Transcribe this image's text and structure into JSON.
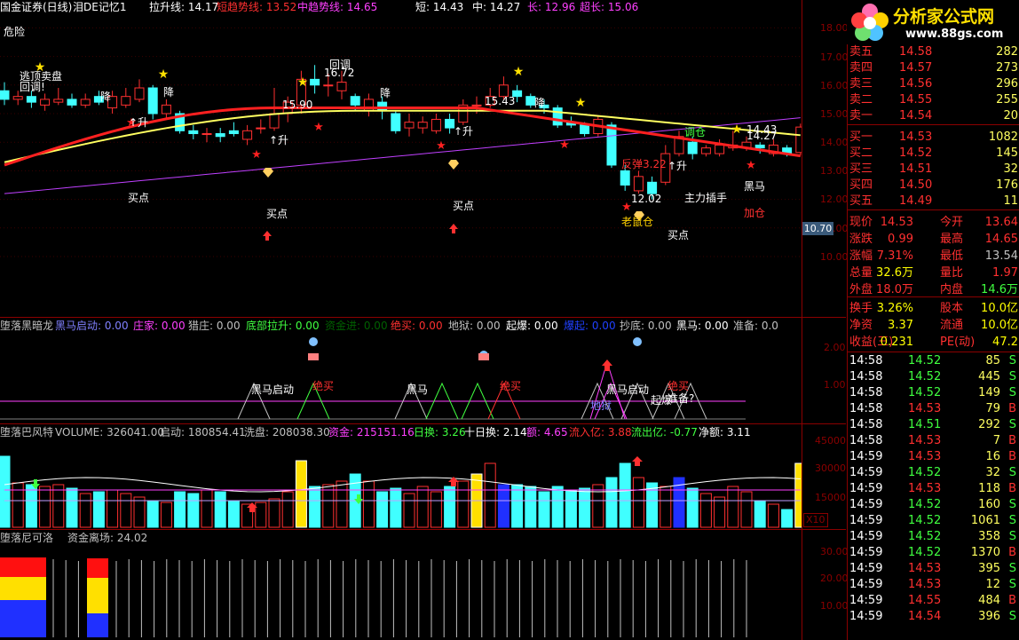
{
  "header": {
    "title": "国金证券(日线)",
    "formula": "泪DE记忆1",
    "items": [
      {
        "label": "拉升线: 14.17",
        "color": "#ffffff"
      },
      {
        "label": "短趋势线: 13.52",
        "color": "#ff3030"
      },
      {
        "label": "中趋势线: 14.65",
        "color": "#ff40ff"
      },
      {
        "label": "短: 14.43",
        "color": "#ffffff"
      },
      {
        "label": "中: 14.27",
        "color": "#ffffff"
      },
      {
        "label": "长: 12.96",
        "color": "#ff40ff"
      },
      {
        "label": "超长: 15.06",
        "color": "#ff40ff"
      }
    ]
  },
  "main_labels": {
    "danger": "危险",
    "price_badge": "10.70"
  },
  "price_axis": [
    "18.00",
    "17.00",
    "16.00",
    "15.00",
    "14.00",
    "13.00",
    "12.00",
    "11.00",
    "10.00"
  ],
  "chart_annotations": [
    {
      "text": "逃顶卖盘",
      "color": "#ffffff"
    },
    {
      "text": "回调!",
      "color": "#ffffff"
    },
    {
      "text": "降",
      "color": "#ffffff"
    },
    {
      "text": "回调",
      "color": "#ffffff"
    },
    {
      "text": "16.72",
      "color": "#ffffff"
    },
    {
      "text": "15.90",
      "color": "#ffffff"
    },
    {
      "text": "15.43",
      "color": "#ffffff"
    },
    {
      "text": "买点",
      "color": "#ffffff"
    },
    {
      "text": "黑马",
      "color": "#ffffff"
    },
    {
      "text": "加仓",
      "color": "#ff3030"
    },
    {
      "text": "主力插手",
      "color": "#ffffff"
    },
    {
      "text": "老鼠仓",
      "color": "#ffd000"
    },
    {
      "text": "12.02",
      "color": "#ffffff"
    },
    {
      "text": "反弹3.22",
      "color": "#ff3030"
    },
    {
      "text": "↑升",
      "color": "#ffffff"
    },
    {
      "text": "14.43",
      "color": "#ffffff"
    },
    {
      "text": "14.27",
      "color": "#ffffff"
    },
    {
      "text": "调仓",
      "color": "#40ff40"
    }
  ],
  "panel2": {
    "title": "堕落黑暗龙",
    "items": [
      {
        "label": "黑马启动: 0.00",
        "color": "#8080ff"
      },
      {
        "label": "庄家: 0.00",
        "color": "#ff40ff"
      },
      {
        "label": "猎庄: 0.00",
        "color": "#c0c0c0"
      },
      {
        "label": "底部拉升: 0.00",
        "color": "#40ff40"
      },
      {
        "label": "资金进: 0.00",
        "color": "#006000"
      },
      {
        "label": "绝买: 0.00",
        "color": "#ff3030"
      },
      {
        "label": "地狱: 0.00",
        "color": "#c0c0c0"
      },
      {
        "label": "起爆: 0.00",
        "color": "#ffffff"
      },
      {
        "label": "爆起: 0.00",
        "color": "#2040ff"
      },
      {
        "label": "抄底: 0.00",
        "color": "#c0c0c0"
      },
      {
        "label": "黑马: 0.00",
        "color": "#ffffff"
      },
      {
        "label": "准备: 0.0",
        "color": "#c0c0c0"
      }
    ],
    "axis": [
      "2.00",
      "1.00"
    ],
    "marks": [
      "黑马启动",
      "绝买",
      "黑马",
      "绝买",
      "黑马启动",
      "绝买",
      "地狱",
      "起爆",
      "准备?"
    ]
  },
  "panel3": {
    "title": "堕落巴风特",
    "items": [
      {
        "label": "VOLUME: 326041.00",
        "color": "#c0c0c0"
      },
      {
        "label": "启动: 180854.41",
        "color": "#c0c0c0"
      },
      {
        "label": "洗盘: 208038.30",
        "color": "#c0c0c0"
      },
      {
        "label": "资金: 215151.16",
        "color": "#ff40ff"
      },
      {
        "label": "日换: 3.26",
        "color": "#40ff40"
      },
      {
        "label": "十日换: 2.14",
        "color": "#ffffff"
      },
      {
        "label": "额: 4.65",
        "color": "#ff40ff"
      },
      {
        "label": "流入亿: 3.88",
        "color": "#ff3030"
      },
      {
        "label": "流出亿: -0.77",
        "color": "#40ff40"
      },
      {
        "label": "净额: 3.11",
        "color": "#ffffff"
      }
    ],
    "axis": [
      "45000",
      "30000",
      "15000"
    ],
    "unit": "X10"
  },
  "panel4": {
    "title": "堕落尼可洛",
    "items": [
      {
        "label": "资金离场: 24.02",
        "color": "#c0c0c0"
      }
    ],
    "axis": [
      "30.00",
      "20.00",
      "10.00"
    ]
  },
  "logo": {
    "text": "分析家公式网",
    "url": "www.88gs.com"
  },
  "quote": {
    "asks": [
      {
        "label": "卖五",
        "price": "14.58",
        "vol": "282"
      },
      {
        "label": "卖四",
        "price": "14.57",
        "vol": "273"
      },
      {
        "label": "卖三",
        "price": "14.56",
        "vol": "296"
      },
      {
        "label": "卖二",
        "price": "14.55",
        "vol": "255"
      },
      {
        "label": "卖一",
        "price": "14.54",
        "vol": "20"
      }
    ],
    "bids": [
      {
        "label": "买一",
        "price": "14.53",
        "vol": "1082"
      },
      {
        "label": "买二",
        "price": "14.52",
        "vol": "145"
      },
      {
        "label": "买三",
        "price": "14.51",
        "vol": "32"
      },
      {
        "label": "买四",
        "price": "14.50",
        "vol": "176"
      },
      {
        "label": "买五",
        "price": "14.49",
        "vol": "11"
      }
    ],
    "stats": [
      {
        "l1": "现价",
        "v1": "14.53",
        "l2": "今开",
        "v2": "13.64",
        "c1": "#ff3030",
        "c2": "#ff3030"
      },
      {
        "l1": "涨跌",
        "v1": "0.99",
        "l2": "最高",
        "v2": "14.65",
        "c1": "#ff3030",
        "c2": "#ff3030"
      },
      {
        "l1": "涨幅",
        "v1": "7.31%",
        "l2": "最低",
        "v2": "13.54",
        "c1": "#ff3030",
        "c2": "#c0c0c0"
      },
      {
        "l1": "总量",
        "v1": "32.6万",
        "l2": "量比",
        "v2": "1.97",
        "c1": "#ffff00",
        "c2": "#ff3030"
      },
      {
        "l1": "外盘",
        "v1": "18.0万",
        "l2": "内盘",
        "v2": "14.6万",
        "c1": "#ff3030",
        "c2": "#40ff40"
      },
      {
        "l1": "换手",
        "v1": "3.26%",
        "l2": "股本",
        "v2": "10.0亿",
        "c1": "#ffff00",
        "c2": "#ffff00"
      },
      {
        "l1": "净资",
        "v1": "3.37",
        "l2": "流通",
        "v2": "10.0亿",
        "c1": "#ffff00",
        "c2": "#ffff00"
      },
      {
        "l1": "收益(三)",
        "v1": "0.231",
        "l2": "PE(动)",
        "v2": "47.2",
        "c1": "#ffff00",
        "c2": "#ffff00"
      }
    ],
    "ticks": [
      {
        "time": "14:58",
        "price": "14.52",
        "vol": "85",
        "side": "S"
      },
      {
        "time": "14:58",
        "price": "14.52",
        "vol": "445",
        "side": "S"
      },
      {
        "time": "14:58",
        "price": "14.52",
        "vol": "149",
        "side": "S"
      },
      {
        "time": "14:58",
        "price": "14.53",
        "vol": "79",
        "side": "B"
      },
      {
        "time": "14:58",
        "price": "14.51",
        "vol": "292",
        "side": "S"
      },
      {
        "time": "14:58",
        "price": "14.53",
        "vol": "7",
        "side": "B"
      },
      {
        "time": "14:59",
        "price": "14.53",
        "vol": "16",
        "side": "B"
      },
      {
        "time": "14:59",
        "price": "14.52",
        "vol": "32",
        "side": "S"
      },
      {
        "time": "14:59",
        "price": "14.53",
        "vol": "118",
        "side": "B"
      },
      {
        "time": "14:59",
        "price": "14.52",
        "vol": "160",
        "side": "S"
      },
      {
        "time": "14:59",
        "price": "14.52",
        "vol": "1061",
        "side": "S"
      },
      {
        "time": "14:59",
        "price": "14.52",
        "vol": "358",
        "side": "S"
      },
      {
        "time": "14:59",
        "price": "14.52",
        "vol": "1370",
        "side": "B"
      },
      {
        "time": "14:59",
        "price": "14.53",
        "vol": "395",
        "side": "S"
      },
      {
        "time": "14:59",
        "price": "14.53",
        "vol": "12",
        "side": "S"
      },
      {
        "time": "14:59",
        "price": "14.55",
        "vol": "484",
        "side": "B"
      },
      {
        "time": "14:59",
        "price": "14.54",
        "vol": "396",
        "side": "S"
      }
    ]
  }
}
